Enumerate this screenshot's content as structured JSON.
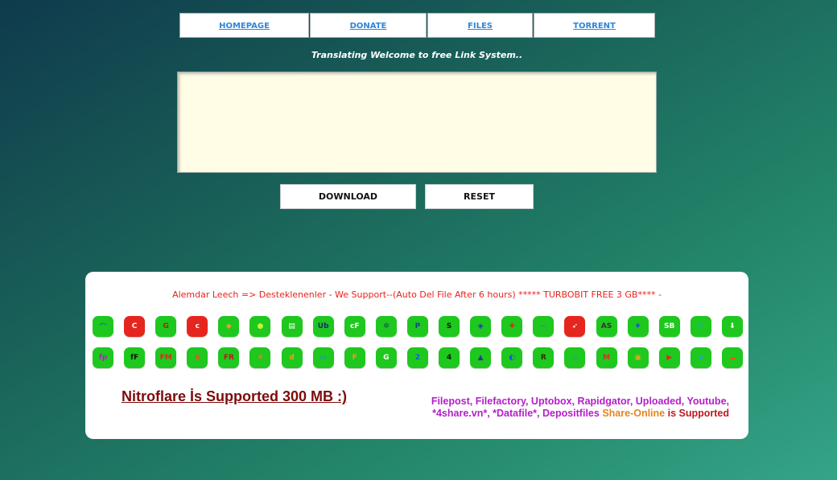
{
  "nav": {
    "homepage": "HOMEPAGE",
    "donate": "DONATE",
    "files": "FILES",
    "torrent": "TORRENT"
  },
  "welcome_text": "Translating Welcome to free Link System..",
  "link_input": {
    "value": "",
    "placeholder": ""
  },
  "buttons": {
    "download": "DOWNLOAD",
    "reset": "RESET"
  },
  "ticker": "Alemdar Leech => Desteklenenler - We Support--(Auto Del File After 6 hours) ***** TURBOBIT FREE 3 GB**** -",
  "host_icons_row1": [
    {
      "name": "host-1-icon",
      "bg": "#1ec81e",
      "glyph": "⌒",
      "fg": "#0b6bd6"
    },
    {
      "name": "host-2-icon",
      "bg": "#e6261e",
      "glyph": "C",
      "fg": "#fff"
    },
    {
      "name": "host-3-icon",
      "bg": "#1ec81e",
      "glyph": "G",
      "fg": "#7a3b00"
    },
    {
      "name": "host-4-icon",
      "bg": "#e6261e",
      "glyph": "c",
      "fg": "#fff"
    },
    {
      "name": "host-5-icon",
      "bg": "#1ec81e",
      "glyph": "◆",
      "fg": "#d9a22a"
    },
    {
      "name": "host-6-icon",
      "bg": "#1ec81e",
      "glyph": "●",
      "fg": "#c6ef3a"
    },
    {
      "name": "host-7-icon",
      "bg": "#1ec81e",
      "glyph": "▤",
      "fg": "#fff"
    },
    {
      "name": "host-8-icon",
      "bg": "#1ec81e",
      "glyph": "Ub",
      "fg": "#1a2a6c"
    },
    {
      "name": "host-9-icon",
      "bg": "#1ec81e",
      "glyph": "cF",
      "fg": "#fff"
    },
    {
      "name": "host-10-icon",
      "bg": "#1ec81e",
      "glyph": "✽",
      "fg": "#0e7a3a"
    },
    {
      "name": "host-11-icon",
      "bg": "#1ec81e",
      "glyph": "P",
      "fg": "#1a3aa8"
    },
    {
      "name": "host-12-icon",
      "bg": "#1ec81e",
      "glyph": "S",
      "fg": "#111"
    },
    {
      "name": "host-13-icon",
      "bg": "#1ec81e",
      "glyph": "◈",
      "fg": "#1a3aa8"
    },
    {
      "name": "host-14-icon",
      "bg": "#1ec81e",
      "glyph": "✚",
      "fg": "#e6261e"
    },
    {
      "name": "host-15-icon",
      "bg": "#1ec81e",
      "glyph": "~",
      "fg": "#1a8ad6"
    },
    {
      "name": "host-16-icon",
      "bg": "#e6261e",
      "glyph": "➶",
      "fg": "#fff"
    },
    {
      "name": "host-17-icon",
      "bg": "#1ec81e",
      "glyph": "AS",
      "fg": "#333"
    },
    {
      "name": "host-18-icon",
      "bg": "#1ec81e",
      "glyph": "♦",
      "fg": "#1a5ad6"
    },
    {
      "name": "host-19-icon",
      "bg": "#1ec81e",
      "glyph": "SB",
      "fg": "#fff"
    },
    {
      "name": "host-20-icon",
      "bg": "#1ec81e",
      "glyph": "C",
      "fg": "#1aa3e6"
    },
    {
      "name": "host-21-icon",
      "bg": "#1ec81e",
      "glyph": "⬇",
      "fg": "#fff"
    }
  ],
  "host_icons_row2": [
    {
      "name": "host-22-icon",
      "bg": "#1ec81e",
      "glyph": "fp",
      "fg": "#b41ec9"
    },
    {
      "name": "host-23-icon",
      "bg": "#1ec81e",
      "glyph": "fF",
      "fg": "#111"
    },
    {
      "name": "host-24-icon",
      "bg": "#1ec81e",
      "glyph": "FM",
      "fg": "#e6261e"
    },
    {
      "name": "host-25-icon",
      "bg": "#1ec81e",
      "glyph": "✖",
      "fg": "#e6561e"
    },
    {
      "name": "host-26-icon",
      "bg": "#1ec81e",
      "glyph": "FR",
      "fg": "#c1161f"
    },
    {
      "name": "host-27-icon",
      "bg": "#1ec81e",
      "glyph": "☀",
      "fg": "#e68a1e"
    },
    {
      "name": "host-28-icon",
      "bg": "#1ec81e",
      "glyph": "d",
      "fg": "#e6a21e"
    },
    {
      "name": "host-29-icon",
      "bg": "#1ec81e",
      "glyph": "▭",
      "fg": "#1a8ad6"
    },
    {
      "name": "host-30-icon",
      "bg": "#1ec81e",
      "glyph": "F",
      "fg": "#e6a21e"
    },
    {
      "name": "host-31-icon",
      "bg": "#1ec81e",
      "glyph": "G",
      "fg": "#fff"
    },
    {
      "name": "host-32-icon",
      "bg": "#1ec81e",
      "glyph": "2",
      "fg": "#1a5ad6"
    },
    {
      "name": "host-33-icon",
      "bg": "#1ec81e",
      "glyph": "4",
      "fg": "#111"
    },
    {
      "name": "host-34-icon",
      "bg": "#1ec81e",
      "glyph": "▲",
      "fg": "#2a3a8c"
    },
    {
      "name": "host-35-icon",
      "bg": "#1ec81e",
      "glyph": "◐",
      "fg": "#1a5ad6"
    },
    {
      "name": "host-36-icon",
      "bg": "#1ec81e",
      "glyph": "R",
      "fg": "#3a2a00"
    },
    {
      "name": "host-37-icon",
      "bg": "#1ec81e",
      "glyph": "♨",
      "fg": "#1a8ad6"
    },
    {
      "name": "host-38-icon",
      "bg": "#1ec81e",
      "glyph": "M",
      "fg": "#e6261e"
    },
    {
      "name": "host-39-icon",
      "bg": "#1ec81e",
      "glyph": "▣",
      "fg": "#e6a21e"
    },
    {
      "name": "host-40-icon",
      "bg": "#1ec81e",
      "glyph": "▶",
      "fg": "#e6261e"
    },
    {
      "name": "host-41-icon",
      "bg": "#1ec81e",
      "glyph": "v",
      "fg": "#1aa3e6"
    },
    {
      "name": "host-42-icon",
      "bg": "#1ec81e",
      "glyph": "☁",
      "fg": "#e6561e"
    }
  ],
  "nitroflare": "Nitroflare İs Supported 300 MB :)",
  "supported": {
    "line1": "Filepost, Filefactory, Uptobox, Rapidgator, Uploaded, Youtube,",
    "line2_part1": "*4share.vn*, *Datafile*, Depositfiles",
    "line2_part2": "Share-Online",
    "line2_part3": "is Supported"
  }
}
